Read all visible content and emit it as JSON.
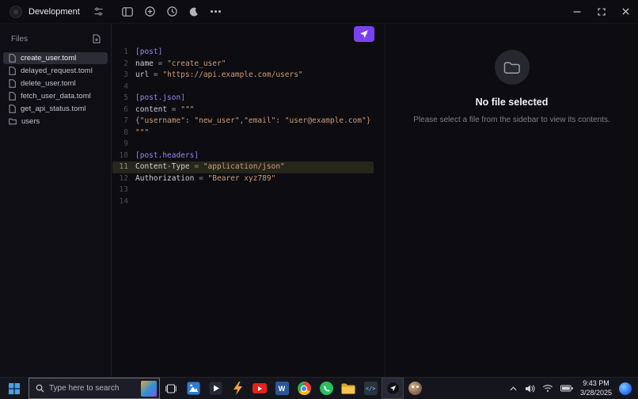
{
  "app": {
    "workspace_name": "Development"
  },
  "sidebar": {
    "header": "Files",
    "items": [
      {
        "label": "create_user.toml",
        "type": "file",
        "selected": true
      },
      {
        "label": "delayed_request.toml",
        "type": "file",
        "selected": false
      },
      {
        "label": "delete_user.toml",
        "type": "file",
        "selected": false
      },
      {
        "label": "fetch_user_data.toml",
        "type": "file",
        "selected": false
      },
      {
        "label": "get_api_status.toml",
        "type": "file",
        "selected": false
      },
      {
        "label": "users",
        "type": "folder",
        "selected": false
      }
    ]
  },
  "editor": {
    "active_line": 11,
    "lines": [
      {
        "num": "1",
        "sec": "[post]"
      },
      {
        "num": "2",
        "key": "name",
        "op": " = ",
        "str": "\"create_user\""
      },
      {
        "num": "3",
        "key": "url",
        "op": " = ",
        "str": "\"https://api.example.com/users\""
      },
      {
        "num": "4"
      },
      {
        "num": "5",
        "sec": "[post.json]"
      },
      {
        "num": "6",
        "key": "content",
        "op": " = ",
        "str": "\"\"\""
      },
      {
        "num": "7",
        "str": "{\"username\": \"new_user\",\"email\": \"user@example.com\"}"
      },
      {
        "num": "8",
        "str": "\"\"\""
      },
      {
        "num": "9"
      },
      {
        "num": "10",
        "sec": "[post.headers]"
      },
      {
        "num": "11",
        "key": "Content-Type",
        "op": " = ",
        "str": "\"application/json\""
      },
      {
        "num": "12",
        "key": "Authorization",
        "op": " = ",
        "str": "\"Bearer xyz789\""
      },
      {
        "num": "13"
      },
      {
        "num": "14"
      }
    ]
  },
  "empty_state": {
    "title": "No file selected",
    "subtitle": "Please select a file from the sidebar to view its contents."
  },
  "taskbar": {
    "search_placeholder": "Type here to search",
    "apps": [
      {
        "id": "photos"
      },
      {
        "id": "media-player"
      },
      {
        "id": "lightning"
      },
      {
        "id": "youtube"
      },
      {
        "id": "word",
        "glyph": "W"
      },
      {
        "id": "chrome"
      },
      {
        "id": "whatsapp"
      },
      {
        "id": "file-explorer"
      },
      {
        "id": "code-editor",
        "glyph": "</>"
      },
      {
        "id": "api-client",
        "active": true
      },
      {
        "id": "gimp"
      }
    ],
    "tray": {
      "time": "9:43 PM",
      "date": "3/28/2025"
    }
  },
  "colors": {
    "accent": "#7b40f4",
    "section_token": "#9e80f7",
    "string_token": "#cf9c7a",
    "active_line_bg": "#26261b",
    "selected_item_bg": "#2c2c36",
    "taskbar_bg": "#15161d"
  }
}
